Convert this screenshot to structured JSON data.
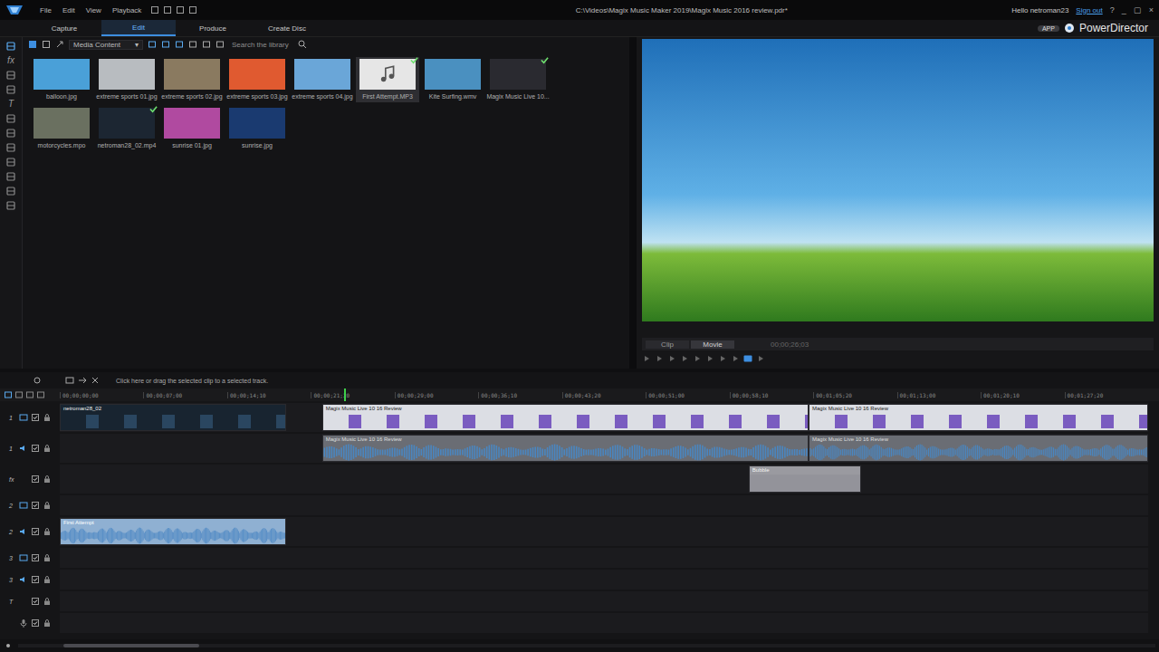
{
  "window": {
    "title": "C:\\Videos\\Magix Music Maker 2019\\Magix Music 2016 review.pdr*",
    "user_greeting": "Hello netroman23",
    "sign_out": "Sign out",
    "help": "?",
    "minimize": "_",
    "maximize": "▢",
    "close": "×"
  },
  "menu": [
    "File",
    "Edit",
    "View",
    "Playback"
  ],
  "tabs": [
    {
      "label": "Capture",
      "selected": false
    },
    {
      "label": "Edit",
      "selected": true
    },
    {
      "label": "Produce",
      "selected": false
    },
    {
      "label": "Create Disc",
      "selected": false
    }
  ],
  "brand": {
    "app_badge": "APP",
    "name": "PowerDirector"
  },
  "side_tools": {
    "effects": "fx",
    "titles": "T"
  },
  "library": {
    "filter": "Media Content",
    "filter_arrow": "▾",
    "search_placeholder": "Search the library",
    "items": [
      {
        "label": "balloon.jpg",
        "kind": "image",
        "checked": false,
        "selected": false,
        "color": "#4aa0d8"
      },
      {
        "label": "extreme sports 01.jpg",
        "kind": "image",
        "checked": false,
        "selected": false,
        "color": "#b8bcc0"
      },
      {
        "label": "extreme sports 02.jpg",
        "kind": "image",
        "checked": false,
        "selected": false,
        "color": "#8a7a60"
      },
      {
        "label": "extreme sports 03.jpg",
        "kind": "image",
        "checked": false,
        "selected": false,
        "color": "#e05a30"
      },
      {
        "label": "extreme sports 04.jpg",
        "kind": "image",
        "checked": false,
        "selected": false,
        "color": "#6aa6d8"
      },
      {
        "label": "First Attempt.MP3",
        "kind": "audio",
        "checked": true,
        "selected": true,
        "color": "#e6e6e6"
      },
      {
        "label": "Kite Surfing.wmv",
        "kind": "video",
        "checked": false,
        "selected": false,
        "color": "#4a90c0"
      },
      {
        "label": "Magix Music Live 10...",
        "kind": "video",
        "checked": true,
        "selected": false,
        "color": "#2a2a30"
      },
      {
        "label": "motorcycles.mpo",
        "kind": "image",
        "checked": false,
        "selected": false,
        "color": "#6a7060"
      },
      {
        "label": "netroman28_02.mp4",
        "kind": "video",
        "checked": true,
        "selected": false,
        "color": "#1c2632"
      },
      {
        "label": "sunrise 01.jpg",
        "kind": "image",
        "checked": false,
        "selected": false,
        "color": "#b04aa0"
      },
      {
        "label": "sunrise.jpg",
        "kind": "image",
        "checked": false,
        "selected": false,
        "color": "#1a3a70"
      }
    ]
  },
  "preview": {
    "modes": [
      {
        "label": "Clip",
        "selected": false
      },
      {
        "label": "Movie",
        "selected": true
      }
    ],
    "timecode": "00;00;26;03"
  },
  "timeline": {
    "hint": "Click here or drag the selected clip to a selected track.",
    "ruler": [
      "00;00;00;00",
      "00;00;07;00",
      "00;00;14;10",
      "00;00;21;20",
      "00;00;29;00",
      "00;00;36;10",
      "00;00;43;20",
      "00;00;51;00",
      "00;00;58;10",
      "00;01;05;20",
      "00;01;13;00",
      "00;01;20;10",
      "00;01;27;20"
    ],
    "duration_seconds": 100,
    "playhead_seconds": 26.1,
    "tracks": [
      {
        "number": "1",
        "kind": "video",
        "expanded": true
      },
      {
        "number": "1",
        "kind": "audio",
        "expanded": true
      },
      {
        "number": "fx",
        "kind": "fx",
        "expanded": true
      },
      {
        "number": "2",
        "kind": "video",
        "expanded": false
      },
      {
        "number": "2",
        "kind": "audio",
        "expanded": true
      },
      {
        "number": "3",
        "kind": "video",
        "expanded": false
      },
      {
        "number": "3",
        "kind": "audio",
        "expanded": false
      },
      {
        "number": "T",
        "kind": "title",
        "expanded": false
      },
      {
        "number": "",
        "kind": "voice",
        "expanded": false
      }
    ],
    "clips": [
      {
        "track": 0,
        "label": "netroman28_02",
        "kind": "video",
        "start": 0,
        "end": 20.8,
        "color": "#2a4660"
      },
      {
        "track": 0,
        "label": "Magix Music Live 10 16 Review",
        "kind": "video",
        "start": 24.1,
        "end": 68.8,
        "color": "#7a5cc0"
      },
      {
        "track": 0,
        "label": "Magix Music Live 10 16 Review",
        "kind": "video",
        "start": 68.8,
        "end": 100,
        "color": "#7a5cc0"
      },
      {
        "track": 1,
        "label": "Magix Music Live 10 16 Review",
        "kind": "audio",
        "start": 24.1,
        "end": 68.8,
        "color": "#4a86c0"
      },
      {
        "track": 1,
        "label": "Magix Music Live 10 16 Review",
        "kind": "audio",
        "start": 68.8,
        "end": 100,
        "color": "#4a86c0"
      },
      {
        "track": 2,
        "label": "Bubble",
        "kind": "effect",
        "start": 63.3,
        "end": 73.6,
        "color": "#8a8a90"
      },
      {
        "track": 4,
        "label": "First Attempt",
        "kind": "audio",
        "start": 0,
        "end": 20.8,
        "color": "#3f7fc0"
      }
    ]
  }
}
